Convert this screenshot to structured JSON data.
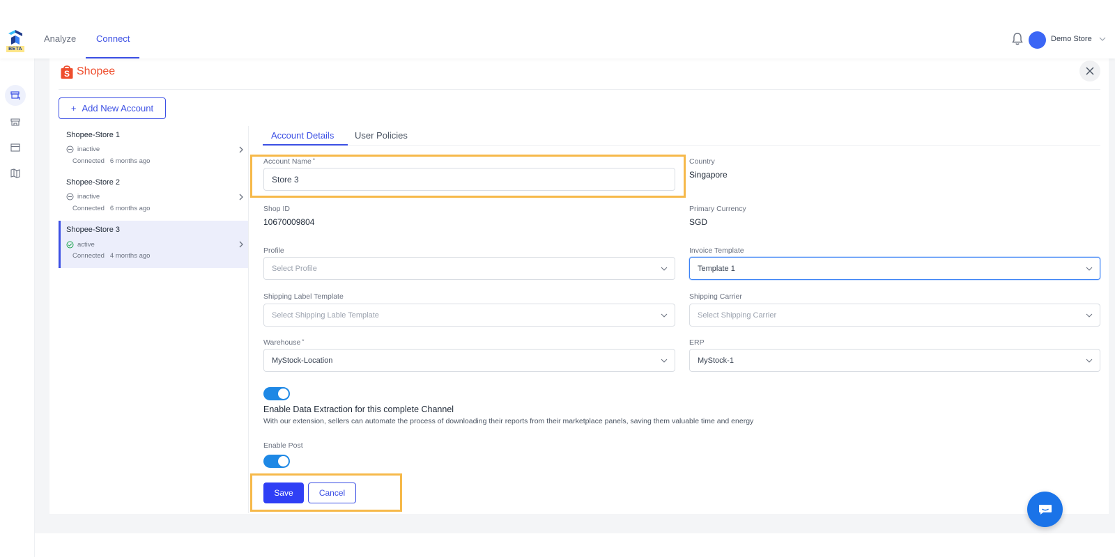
{
  "app": {
    "badge": "BETA",
    "nav": {
      "analyze": "Analyze",
      "connect": "Connect"
    },
    "store_name": "Demo Store"
  },
  "channel": {
    "name": "Shopee"
  },
  "add_account_label": "Add New Account",
  "accounts": [
    {
      "name": "Shopee-Store 1",
      "status": "inactive",
      "connected": "Connected",
      "ago": "6 months ago"
    },
    {
      "name": "Shopee-Store 2",
      "status": "inactive",
      "connected": "Connected",
      "ago": "6 months ago"
    },
    {
      "name": "Shopee-Store 3",
      "status": "active",
      "connected": "Connected",
      "ago": "4 months ago"
    }
  ],
  "tabs": [
    "Account Details",
    "User Policies"
  ],
  "form": {
    "account_name": {
      "label": "Account Name",
      "required": "*",
      "value": "Store 3"
    },
    "country": {
      "label": "Country",
      "value": "Singapore"
    },
    "shop_id": {
      "label": "Shop ID",
      "value": "10670009804"
    },
    "primary_currency": {
      "label": "Primary Currency",
      "value": "SGD"
    },
    "profile": {
      "label": "Profile",
      "placeholder": "Select Profile"
    },
    "invoice_template": {
      "label": "Invoice Template",
      "value": "Template 1"
    },
    "shipping_label_template": {
      "label": "Shipping Label Template",
      "placeholder": "Select Shipping Lable Template"
    },
    "shipping_carrier": {
      "label": "Shipping Carrier",
      "placeholder": "Select Shipping Carrier"
    },
    "warehouse": {
      "label": "Warehouse",
      "required": "*",
      "value": "MyStock-Location"
    },
    "erp": {
      "label": "ERP",
      "value": "MyStock-1"
    }
  },
  "extraction": {
    "enabled": true,
    "title": "Enable Data Extraction for this complete Channel",
    "description": "With our extension, sellers can automate the process of downloading their reports from their marketplace panels, saving them valuable time and energy"
  },
  "enable_post": {
    "label": "Enable Post",
    "enabled": true
  },
  "actions": {
    "save": "Save",
    "cancel": "Cancel"
  },
  "colors": {
    "accent": "#3b4fe4",
    "shopee": "#ee4d2d",
    "highlight": "#f6b94a",
    "toggle": "#1e88e5"
  }
}
